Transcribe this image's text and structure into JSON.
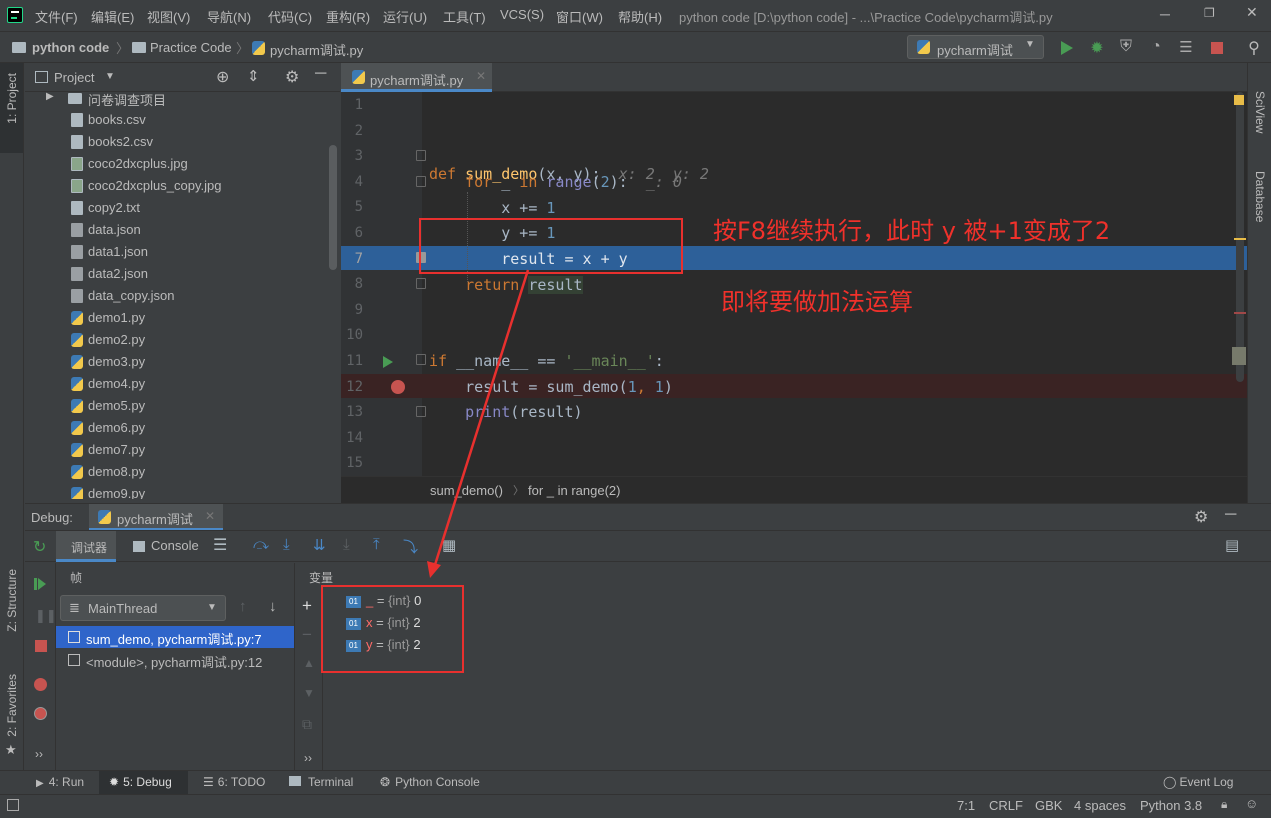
{
  "menubar": {
    "items": [
      "文件(F)",
      "编辑(E)",
      "视图(V)",
      "导航(N)",
      "代码(C)",
      "重构(R)",
      "运行(U)",
      "工具(T)",
      "VCS(S)",
      "窗口(W)",
      "帮助(H)"
    ],
    "window_title": "python code [D:\\python code] - ...\\Practice Code\\pycharm调试.py"
  },
  "navbar": {
    "crumbs": [
      "python code",
      "Practice Code",
      "pycharm调试.py"
    ],
    "run_config": "pycharm调试"
  },
  "side_tabs": {
    "project": "1: Project",
    "structure": "Z: Structure",
    "favorites": "2: Favorites",
    "sciview": "SciView",
    "database": "Database"
  },
  "project": {
    "title": "Project",
    "items": [
      {
        "name": "问卷调查项目",
        "type": "folder"
      },
      {
        "name": "books.csv",
        "type": "text"
      },
      {
        "name": "books2.csv",
        "type": "text"
      },
      {
        "name": "coco2dxcplus.jpg",
        "type": "image"
      },
      {
        "name": "coco2dxcplus_copy.jpg",
        "type": "image"
      },
      {
        "name": "copy2.txt",
        "type": "text"
      },
      {
        "name": "data.json",
        "type": "json"
      },
      {
        "name": "data1.json",
        "type": "json"
      },
      {
        "name": "data2.json",
        "type": "json"
      },
      {
        "name": "data_copy.json",
        "type": "json"
      },
      {
        "name": "demo1.py",
        "type": "python"
      },
      {
        "name": "demo2.py",
        "type": "python"
      },
      {
        "name": "demo3.py",
        "type": "python"
      },
      {
        "name": "demo4.py",
        "type": "python"
      },
      {
        "name": "demo5.py",
        "type": "python"
      },
      {
        "name": "demo6.py",
        "type": "python"
      },
      {
        "name": "demo7.py",
        "type": "python"
      },
      {
        "name": "demo8.py",
        "type": "python"
      },
      {
        "name": "demo9.py",
        "type": "python"
      }
    ]
  },
  "editor": {
    "tab": "pycharm调试.py",
    "line_numbers": [
      "1",
      "2",
      "3",
      "4",
      "5",
      "6",
      "7",
      "8",
      "9",
      "10",
      "11",
      "12",
      "13",
      "14",
      "15"
    ],
    "code": {
      "l3_kw": "def",
      "l3_fn": "sum_demo",
      "l3_rest": "(x, y):",
      "l3_hint": "x: 2  y: 2",
      "l4_kw1": "for",
      "l4_mid": " _ ",
      "l4_kw2": "in",
      "l4_bi": "range",
      "l4_p1": "(",
      "l4_num": "2",
      "l4_p2": "):",
      "l4_hint": "_: 0",
      "l5_a": "x += ",
      "l5_num": "1",
      "l6_a": "y += ",
      "l6_num": "1",
      "l7": "result = x + y",
      "l8_kw": "return",
      "l8_var": "result",
      "l11_kw": "if",
      "l11_a": " __name__ == ",
      "l11_str": "'__main__'",
      "l11_b": ":",
      "l12_a": "result = sum_demo(",
      "l12_n1": "1",
      "l12_c": ", ",
      "l12_n2": "1",
      "l12_b": ")",
      "l13_bi": "print",
      "l13_a": "(result)"
    },
    "breadcrumb": [
      "sum_demo()",
      "for _ in range(2)"
    ]
  },
  "debug": {
    "label": "Debug:",
    "session_tab": "pycharm调试",
    "tabs": {
      "debugger": "调试器",
      "console": "Console"
    },
    "frames_header": "帧",
    "vars_header": "变量",
    "thread": "MainThread",
    "frames": [
      "sum_demo, pycharm调试.py:7",
      "<module>, pycharm调试.py:12"
    ],
    "variables": [
      {
        "name": "_",
        "type": "{int}",
        "value": "0",
        "badge": "01"
      },
      {
        "name": "x",
        "type": "{int}",
        "value": "2",
        "badge": "01"
      },
      {
        "name": "y",
        "type": "{int}",
        "value": "2",
        "badge": "01"
      }
    ]
  },
  "annotations": {
    "line1": "按F8继续执行，此时 y 被+1变成了2",
    "line2": "即将要做加法运算",
    "color": "#e8302e"
  },
  "bottom_tabs": {
    "run": "4: Run",
    "debug": "5: Debug",
    "todo": "6: TODO",
    "terminal": "Terminal",
    "python_console": "Python Console",
    "event_log": "Event Log"
  },
  "status": {
    "position": "7:1",
    "line_sep": "CRLF",
    "encoding": "GBK",
    "indent": "4 spaces",
    "interpreter": "Python 3.8"
  },
  "colors": {
    "accent": "#2f65ca",
    "exec_line": "#2d6099",
    "run_green": "#499c54",
    "stop_red": "#c75450"
  }
}
